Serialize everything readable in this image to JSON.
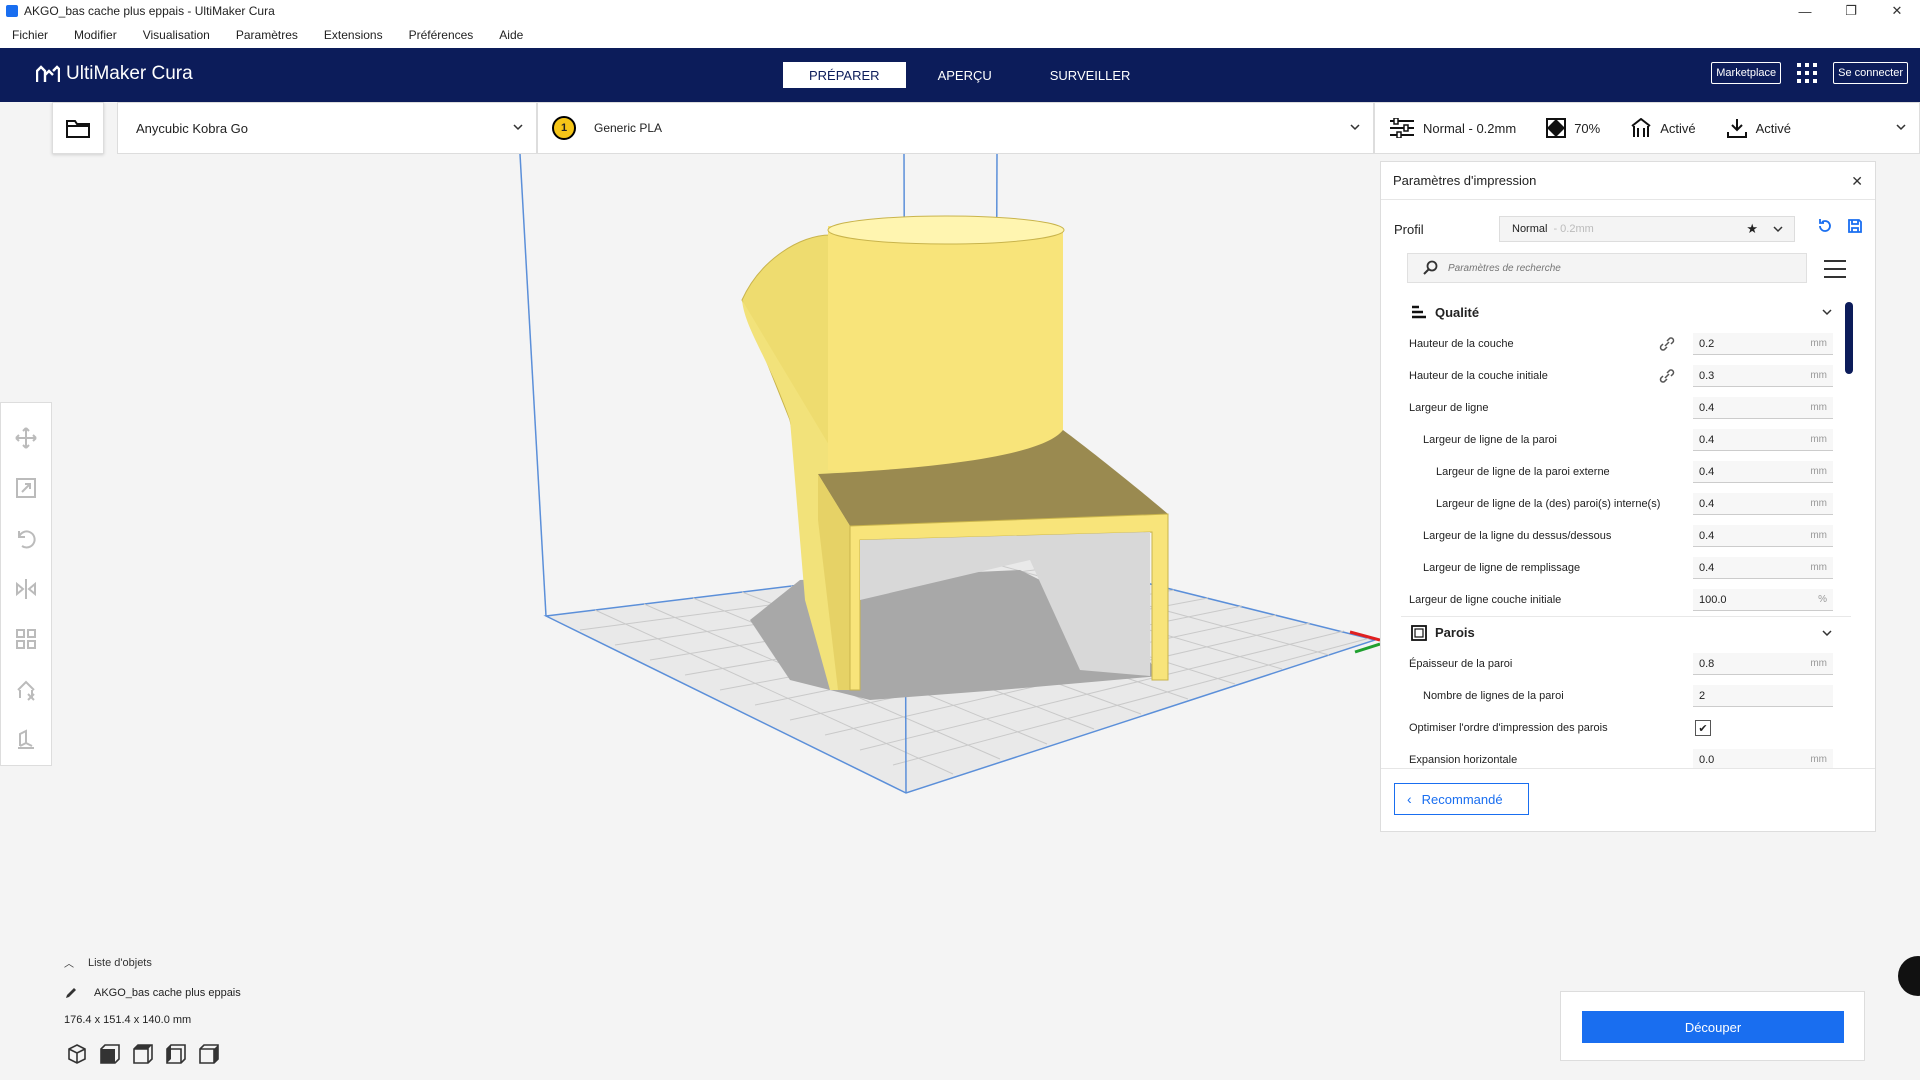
{
  "window": {
    "title": "AKGO_bas cache plus eppais - UltiMaker Cura",
    "minimize": "—",
    "maximize": "❐",
    "close": "✕"
  },
  "menu": [
    "Fichier",
    "Modifier",
    "Visualisation",
    "Paramètres",
    "Extensions",
    "Préférences",
    "Aide"
  ],
  "header": {
    "logo": "UltiMaker Cura",
    "stages": [
      "PRÉPARER",
      "APERÇU",
      "SURVEILLER"
    ],
    "active_stage": "PRÉPARER",
    "marketplace": "Marketplace",
    "signin": "Se connecter"
  },
  "toolbar": {
    "printer": "Anycubic Kobra Go",
    "extruder_number": "1",
    "material": "Generic PLA",
    "profile": "Normal - 0.2mm",
    "infill": "70%",
    "support": "Activé",
    "adhesion": "Activé"
  },
  "panel": {
    "title": "Paramètres d'impression",
    "profile_label": "Profil",
    "profile_name": "Normal",
    "profile_sub": "- 0.2mm",
    "search_placeholder": "Paramètres de recherche",
    "categories": [
      {
        "name": "Qualité",
        "settings": [
          {
            "label": "Hauteur de la couche",
            "value": "0.2",
            "unit": "mm",
            "indent": 0,
            "linked": true
          },
          {
            "label": "Hauteur de la couche initiale",
            "value": "0.3",
            "unit": "mm",
            "indent": 0,
            "linked": true
          },
          {
            "label": "Largeur de ligne",
            "value": "0.4",
            "unit": "mm",
            "indent": 0
          },
          {
            "label": "Largeur de ligne de la paroi",
            "value": "0.4",
            "unit": "mm",
            "indent": 1
          },
          {
            "label": "Largeur de ligne de la paroi externe",
            "value": "0.4",
            "unit": "mm",
            "indent": 2
          },
          {
            "label": "Largeur de ligne de la (des) paroi(s) interne(s)",
            "value": "0.4",
            "unit": "mm",
            "indent": 2
          },
          {
            "label": "Largeur de la ligne du dessus/dessous",
            "value": "0.4",
            "unit": "mm",
            "indent": 1
          },
          {
            "label": "Largeur de ligne de remplissage",
            "value": "0.4",
            "unit": "mm",
            "indent": 1
          },
          {
            "label": "Largeur de ligne couche initiale",
            "value": "100.0",
            "unit": "%",
            "indent": 0
          }
        ]
      },
      {
        "name": "Parois",
        "settings": [
          {
            "label": "Épaisseur de la paroi",
            "value": "0.8",
            "unit": "mm",
            "indent": 0
          },
          {
            "label": "Nombre de lignes de la paroi",
            "value": "2",
            "unit": "",
            "indent": 1
          },
          {
            "label": "Optimiser l'ordre d'impression des parois",
            "value": "✔",
            "unit": "",
            "indent": 0,
            "checkbox": true
          },
          {
            "label": "Expansion horizontale",
            "value": "0.0",
            "unit": "mm",
            "indent": 0
          }
        ]
      }
    ],
    "recommended": "Recommandé"
  },
  "objects": {
    "header": "Liste d'objets",
    "item": "AKGO_bas cache plus eppais",
    "dimensions": "176.4 x 151.4 x 140.0 mm"
  },
  "slice": {
    "button": "Découper"
  },
  "colors": {
    "header_bg": "#0c1c5a",
    "accent": "#196ef0",
    "model": "#f8e47a"
  },
  "icons": {
    "open": "folder-icon",
    "search": "search-icon",
    "menu": "hamburger-icon",
    "reset": "reset-icon",
    "save": "save-icon"
  }
}
